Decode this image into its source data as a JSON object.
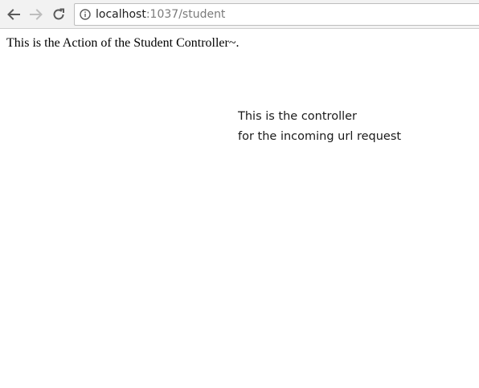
{
  "browser": {
    "address_host": "localhost",
    "address_path": ":1037/student",
    "icons": {
      "back": "arrow-left-icon",
      "forward": "arrow-right-icon",
      "reload": "reload-icon",
      "site_info": "info-circle-icon"
    }
  },
  "page": {
    "action_text": "This is the Action of the Student Controller~.",
    "annotation_line1": "This is the controller",
    "annotation_line2": "for the incoming url request"
  }
}
